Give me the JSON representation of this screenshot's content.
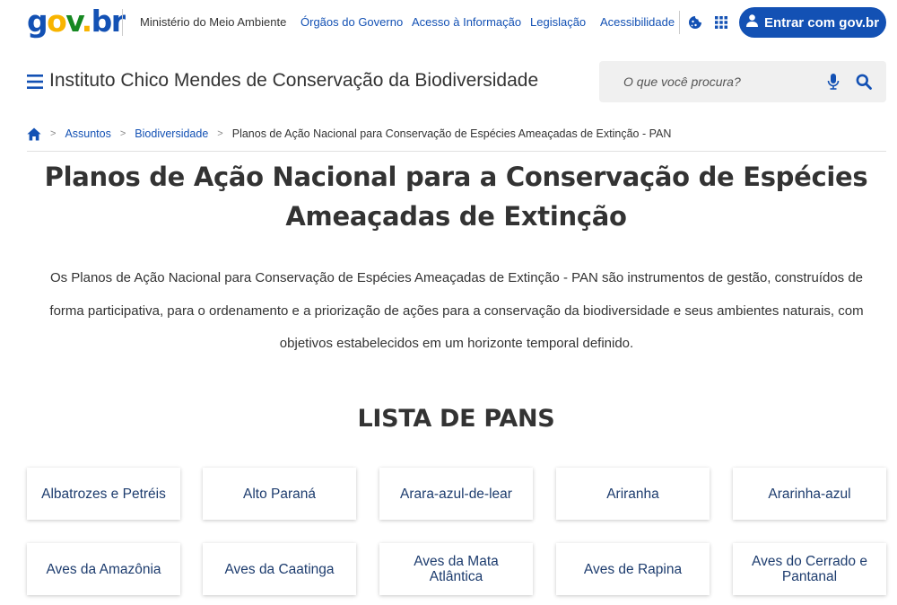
{
  "govbar": {
    "logo": {
      "g": "g",
      "o": "o",
      "v": "v",
      "dot": ".",
      "b": "b",
      "r": "r"
    },
    "ministry": "Ministério do Meio Ambiente",
    "links": [
      "Órgãos do Governo",
      "Acesso à Informação",
      "Legislação",
      "Acessibilidade"
    ],
    "login_label": "Entrar com gov.br"
  },
  "header": {
    "site_title": "Instituto Chico Mendes de Conservação da Biodiversidade",
    "search_placeholder": "O que você procura?"
  },
  "breadcrumb": {
    "items": [
      "Assuntos",
      "Biodiversidade"
    ],
    "current": "Planos de Ação Nacional para Conservação de Espécies Ameaçadas de Extinção - PAN"
  },
  "main": {
    "title_line1": "Planos de Ação Nacional para a Conservação de Espécies",
    "title_line2": "Ameaçadas de Extinção",
    "intro_lines": [
      "Os Planos de Ação Nacional para Conservação de Espécies Ameaçadas de Extinção - PAN são instrumentos de gestão, construídos de",
      "forma participativa, para o ordenamento e a priorização de ações para a conservação da biodiversidade e seus ambientes naturais, com",
      "objetivos estabelecidos em um horizonte temporal definido."
    ],
    "list_title": "LISTA DE PANS",
    "pans": [
      "Albatrozes e Petréis",
      "Alto Paraná",
      "Arara-azul-de-lear",
      "Ariranha",
      "Ararinha-azul",
      "Aves da Amazônia",
      "Aves da Caatinga",
      "Aves da Mata Atlântica",
      "Aves de Rapina",
      "Aves do Cerrado e Pantanal"
    ]
  },
  "colors": {
    "primary_blue": "#1351b4",
    "text": "#333333",
    "card_text": "#1d3c6e",
    "search_bg": "#f0f0f0"
  }
}
